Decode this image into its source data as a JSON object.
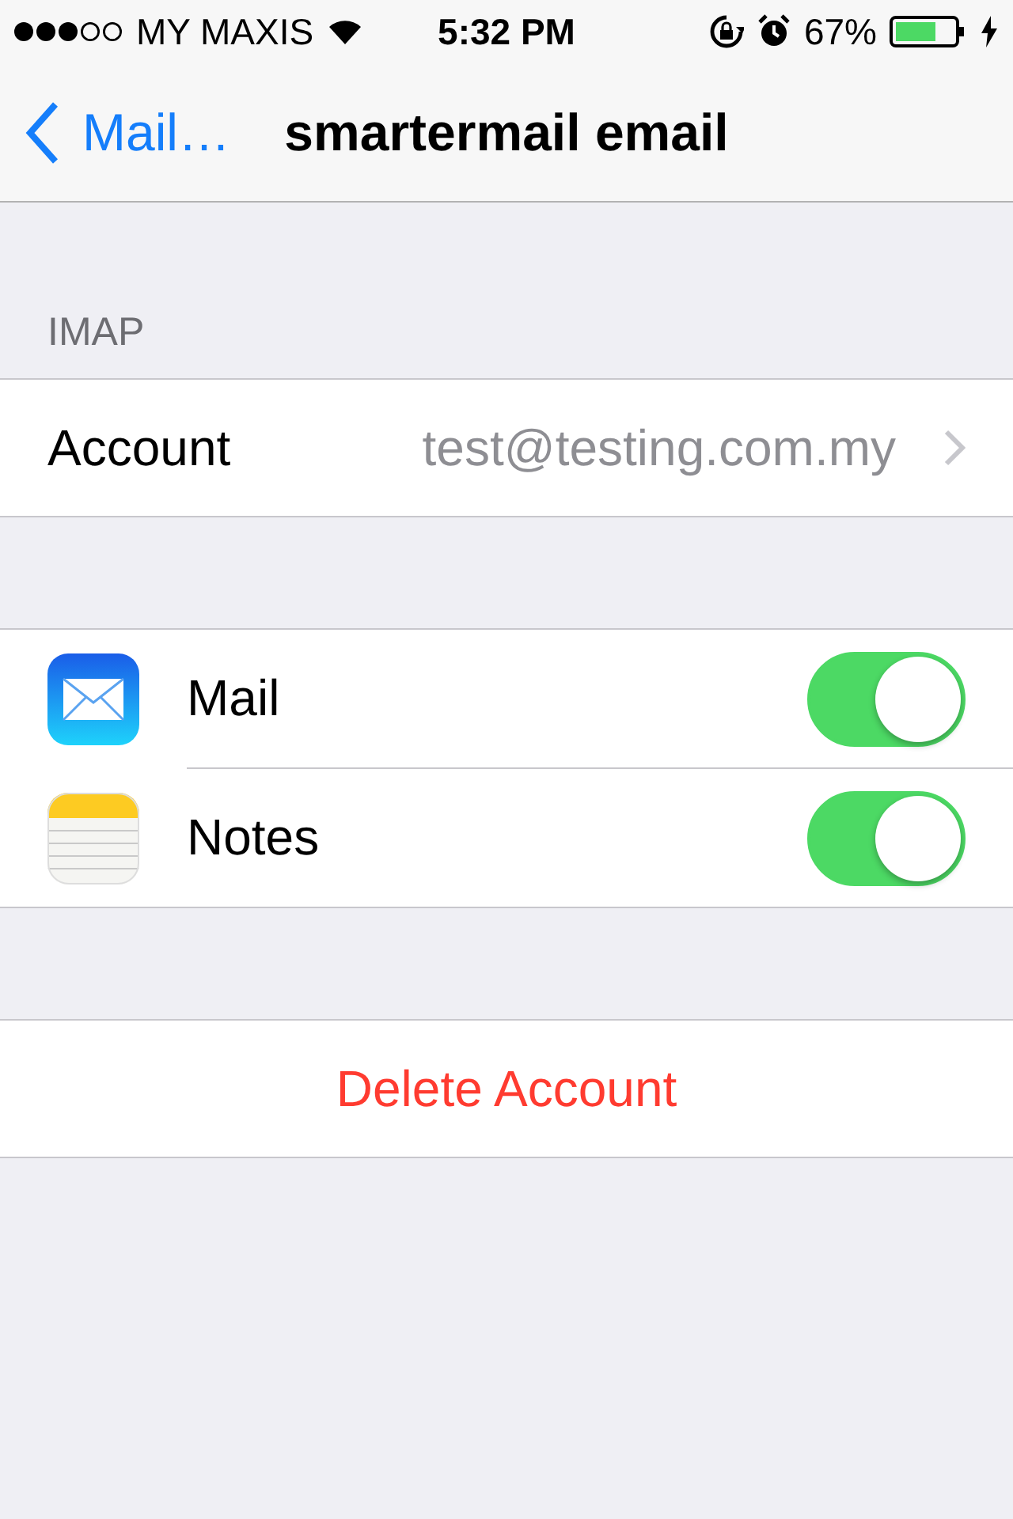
{
  "status_bar": {
    "carrier": "MY MAXIS",
    "time": "5:32 PM",
    "battery": "67%"
  },
  "nav": {
    "back": "Mail…",
    "title": "smartermail email"
  },
  "account_section": {
    "header": "IMAP",
    "rows": [
      {
        "label": "Account",
        "value": "test@testing.com.my"
      }
    ]
  },
  "services": [
    {
      "kind": "mail",
      "label": "Mail",
      "on": true
    },
    {
      "kind": "notes",
      "label": "Notes",
      "on": true
    }
  ],
  "delete_button": "Delete Account"
}
